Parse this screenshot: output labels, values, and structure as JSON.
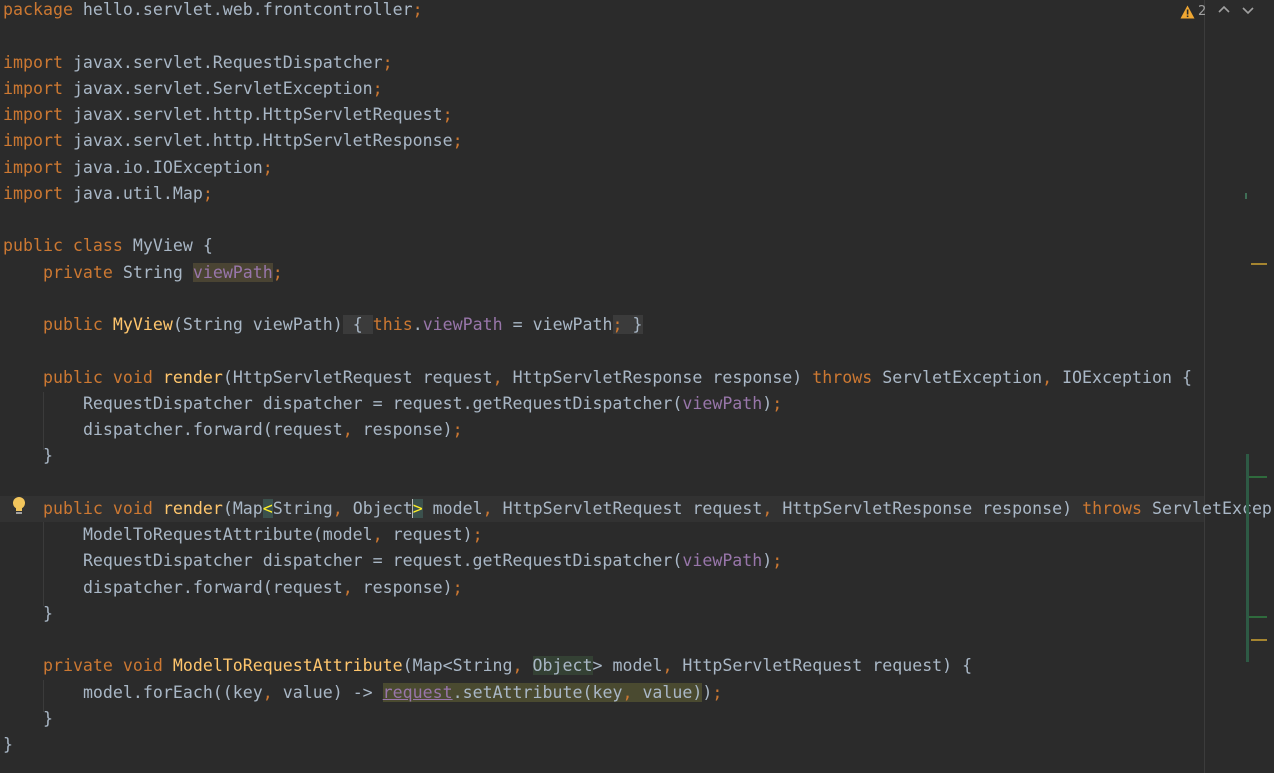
{
  "editor": {
    "language": "Java",
    "inspection": {
      "warning_count": "2",
      "icon": "warning-triangle-icon",
      "prev_icon": "chevron-up-icon",
      "next_icon": "chevron-down-icon"
    },
    "intention_icon": "lightbulb-icon",
    "colors": {
      "background": "#2b2b2b",
      "keyword": "#cc7832",
      "field": "#9876aa",
      "method": "#ffc66d",
      "text": "#a9b7c6",
      "warning": "#f0a732"
    },
    "code": {
      "pkg": {
        "kw": "package",
        "name": " hello.servlet.web.frontcontroller",
        "semi": ";"
      },
      "imports": [
        {
          "kw": "import",
          "name": " javax.servlet.RequestDispatcher",
          "semi": ";"
        },
        {
          "kw": "import",
          "name": " javax.servlet.ServletException",
          "semi": ";"
        },
        {
          "kw": "import",
          "name": " javax.servlet.http.HttpServletRequest",
          "semi": ";"
        },
        {
          "kw": "import",
          "name": " javax.servlet.http.HttpServletResponse",
          "semi": ";"
        },
        {
          "kw": "import",
          "name": " java.io.IOException",
          "semi": ";"
        },
        {
          "kw": "import",
          "name": " java.util.Map",
          "semi": ";"
        }
      ],
      "class_decl": {
        "kw": "public class",
        "rest": " MyView {"
      },
      "field_decl": {
        "kw": "private",
        "type": " String ",
        "name": "viewPath",
        "semi": ";"
      },
      "ctor": {
        "kw": "public",
        "name": "MyView",
        "params": "(String viewPath)",
        "open": "{",
        "this_kw": "this",
        "dot": ".",
        "field": "viewPath",
        "assign": " = viewPath",
        "semi": ";",
        "close": "}"
      },
      "render1": {
        "kw": "public void",
        "name": "render",
        "params_a": "(HttpServletRequest request",
        "comma": ",",
        "params_b": " HttpServletResponse response) ",
        "throws": "throws",
        "ex1": " ServletException",
        "comma2": ",",
        "ex2": " IOException {",
        "body1_a": "RequestDispatcher dispatcher = request.getRequestDispatcher(",
        "body1_field": "viewPath",
        "body1_b": ")",
        "body1_semi": ";",
        "body2_a": "dispatcher.forward(request",
        "body2_comma": ",",
        "body2_b": " response)",
        "body2_semi": ";",
        "close": "}"
      },
      "render2": {
        "kw": "public void",
        "name": "render",
        "p_open": "(Map",
        "lt": "<",
        "p_string": "String",
        "comma": ",",
        "p_object": " Object",
        "gt": ">",
        "p_model": " model",
        "comma2": ",",
        "p_req": " HttpServletRequest request",
        "comma3": ",",
        "p_resp": " HttpServletResponse response) ",
        "throws": "throws",
        "ex1": " ServletExcep",
        "body1_a": "ModelToRequestAttribute(model",
        "body1_comma": ",",
        "body1_b": " request)",
        "body1_semi": ";",
        "body2_a": "RequestDispatcher dispatcher = request.getRequestDispatcher(",
        "body2_field": "viewPath",
        "body2_b": ")",
        "body2_semi": ";",
        "body3_a": "dispatcher.forward(request",
        "body3_comma": ",",
        "body3_b": " response)",
        "body3_semi": ";",
        "close": "}"
      },
      "helper": {
        "kw": "private void",
        "name": "ModelToRequestAttribute",
        "p_a": "(Map<String",
        "comma": ",",
        "p_space": " ",
        "p_object": "Object",
        "p_b": "> model",
        "comma2": ",",
        "p_c": " HttpServletRequest request) {",
        "body_a": "model.forEach((key",
        "body_comma": ",",
        "body_b": " value) -> ",
        "body_req": "request",
        "body_c": ".setAttribute(key",
        "body_comma2": ",",
        "body_d": " value)",
        "body_e": ")",
        "body_semi": ";",
        "close": "}"
      },
      "class_close": "}"
    }
  }
}
